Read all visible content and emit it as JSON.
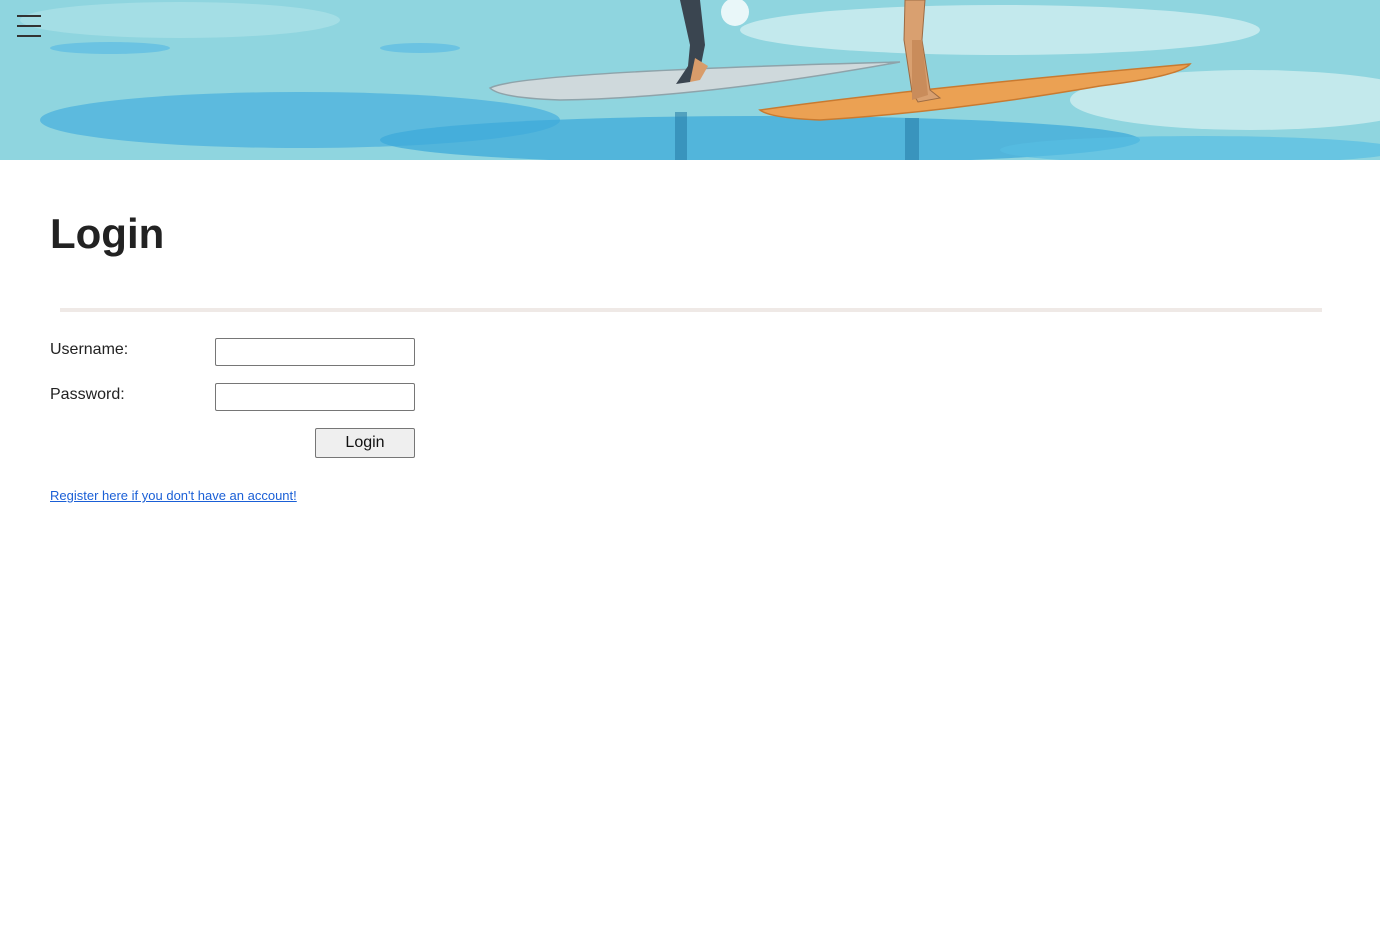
{
  "header": {
    "menu_icon": "hamburger-menu-icon",
    "banner_image": "paddleboarders-on-water-illustration"
  },
  "login": {
    "title": "Login",
    "username_label": "Username:",
    "username_value": "",
    "password_label": "Password:",
    "password_value": "",
    "submit_label": "Login",
    "register_link": "Register here if you don't have an account!"
  },
  "colors": {
    "link": "#1a5fd6",
    "divider": "#efe9e6",
    "banner_water": "#7fd0dd"
  }
}
